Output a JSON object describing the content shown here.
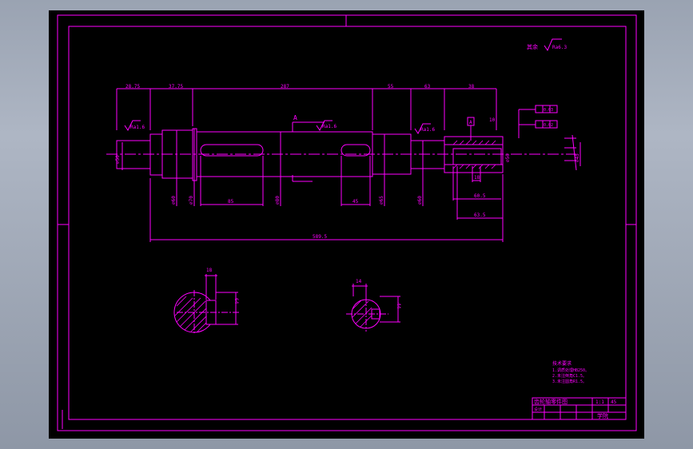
{
  "drawing": {
    "surface_label": "其余",
    "surface_roughness": "Ra6.3",
    "roughness_marks": [
      "Ra1.6",
      "Ra1.6",
      "Ra1.6"
    ],
    "section_letter": "A",
    "datum_label": "A",
    "top_dims": [
      "28.75",
      "37.75",
      "287",
      "55",
      "63",
      "38"
    ],
    "key_widths": [
      "85",
      "45"
    ],
    "diameters": [
      "⌀50",
      "⌀60",
      "⌀70",
      "⌀80",
      "⌀65",
      "⌀60",
      "⌀50"
    ],
    "right_dims": [
      "60.5",
      "63.5",
      "18",
      "10",
      "⌀45"
    ],
    "total_length": "589.5",
    "tol_frame_1": "0.03",
    "tol_frame_2": "0.02",
    "section_1": {
      "width": "18",
      "depth": "64"
    },
    "section_2": {
      "width": "14",
      "depth": "44"
    },
    "notes_title": "技术要求",
    "notes": [
      "1.调质处理HB250。",
      "2.未注倒角C1.5。",
      "3.未注圆角R1.5。"
    ],
    "title_block": {
      "title": "齿轮轴零件图",
      "org": "学院",
      "scale": "1:1",
      "material": "45",
      "designer": "设计"
    }
  },
  "colors": {
    "line": "#ff00ff",
    "background": "#000000",
    "chrome": "#9aa3b2"
  }
}
